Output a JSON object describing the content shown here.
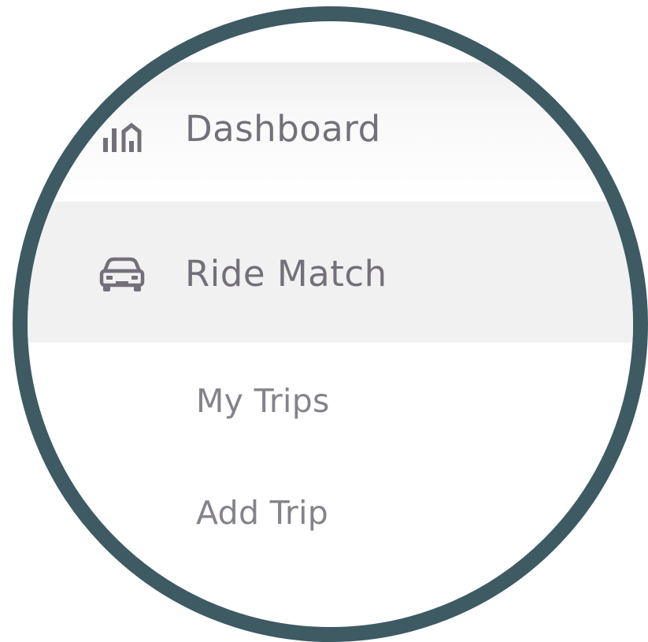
{
  "colors": {
    "ring": "#3e5a63",
    "text": "#74707a",
    "active_bg": "#f1f1f1"
  },
  "menu": {
    "items": [
      {
        "label": "Dashboard",
        "icon": "chart-bar-icon"
      },
      {
        "label": "Ride Match",
        "icon": "car-icon"
      }
    ],
    "subitems": [
      {
        "label": "My Trips"
      },
      {
        "label": "Add Trip"
      }
    ]
  }
}
